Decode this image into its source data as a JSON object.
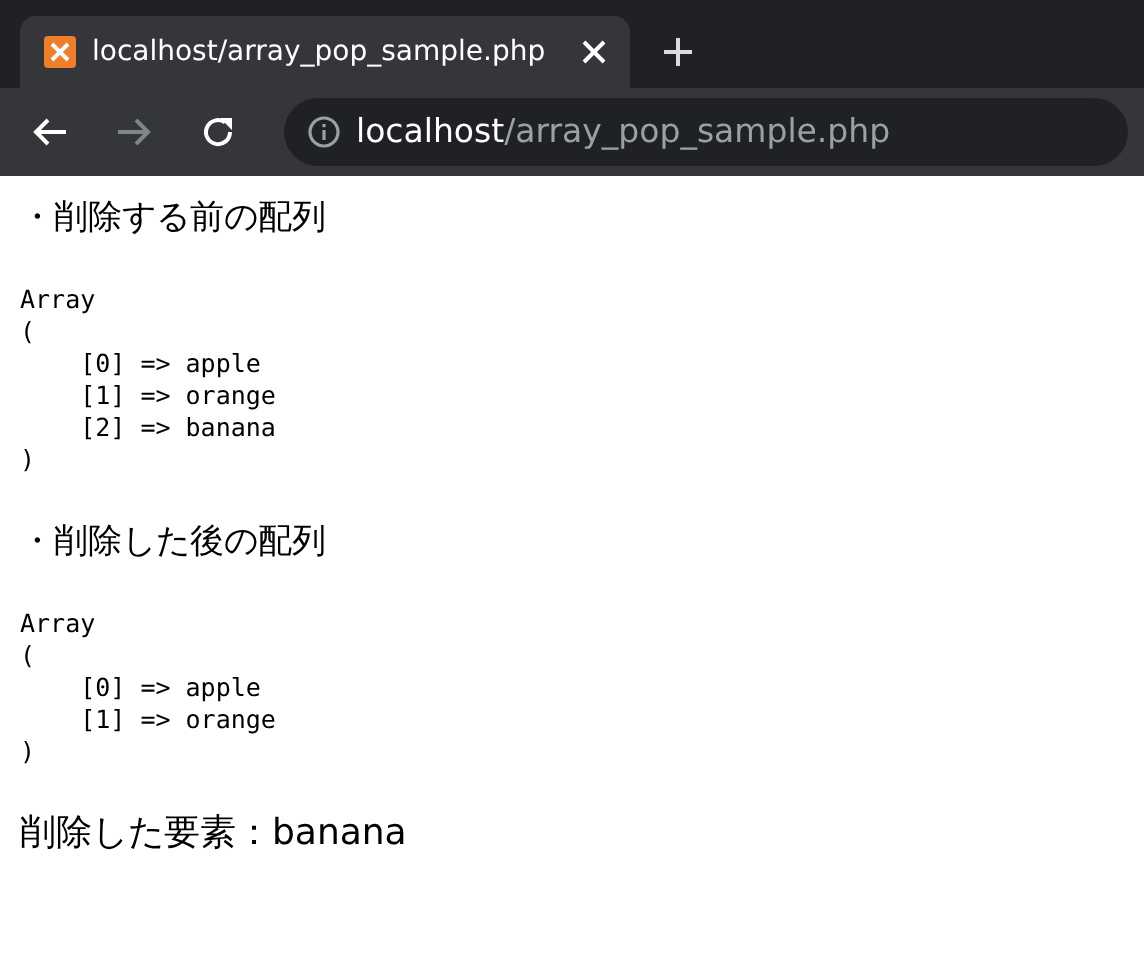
{
  "browser": {
    "tab": {
      "title": "localhost/array_pop_sample.php",
      "selected": true
    },
    "address": {
      "host": "localhost",
      "path": "/array_pop_sample.php"
    }
  },
  "content": [
    {
      "kind": "heading",
      "text": "・削除する前の配列"
    },
    {
      "kind": "pre",
      "lines": [
        "Array",
        "(",
        "    [0] => apple",
        "    [1] => orange",
        "    [2] => banana",
        ")"
      ]
    },
    {
      "kind": "heading",
      "text": "・削除した後の配列"
    },
    {
      "kind": "pre",
      "lines": [
        "Array",
        "(",
        "    [0] => apple",
        "    [1] => orange",
        ")"
      ]
    },
    {
      "kind": "result",
      "text": "削除した要素：banana"
    }
  ]
}
